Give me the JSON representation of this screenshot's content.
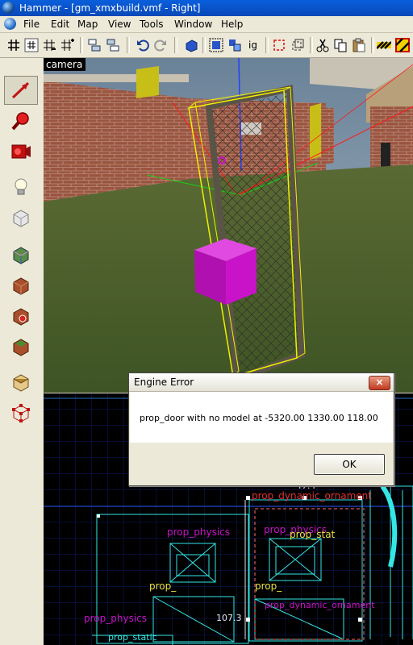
{
  "window": {
    "title": "Hammer - [gm_xmxbuild.vmf - Right]"
  },
  "menu": {
    "items": [
      "File",
      "Edit",
      "Map",
      "View",
      "Tools",
      "Window",
      "Help"
    ]
  },
  "toolbar": {
    "items": [
      "grid-icon",
      "grid-toggle-icon",
      "grid-smaller-icon",
      "grid-larger-icon",
      "group-icon",
      "ungroup-icon",
      "undo-icon",
      "redo-icon",
      "carve-icon",
      "selection-icon",
      "texture-lock-icon",
      "ignore-groups-label",
      "hide-icon",
      "show-icon",
      "cut-icon",
      "copy-icon",
      "paste-icon",
      "hazard-a-icon",
      "hazard-b-icon"
    ],
    "ignore_label": "ig"
  },
  "tools": [
    "selection-tool-icon",
    "magnify-tool-icon",
    "camera-tool-icon",
    "entity-tool-icon",
    "block-tool-icon",
    "texture-app-icon",
    "apply-texture-icon",
    "decal-tool-icon",
    "overlay-tool-icon",
    "clipping-tool-icon",
    "vertex-tool-icon"
  ],
  "camera_view": {
    "label": "camera"
  },
  "view2d": {
    "labels": {
      "prop_dynamic_ornament": "prop_dynamic_ornament",
      "measure_top": "47.4",
      "prop_physics_1": "prop_physics",
      "prop_physics_2": "prop_physics",
      "prop_static_1": "prop_stat",
      "prop_1": "prop_",
      "prop_2": "prop_",
      "prop_physics_3": "prop_physics",
      "measure_left": "107.3",
      "prop_dynamic_ornament_2": "prop_dynamic_ornament",
      "prop_static_2": "prop_static"
    }
  },
  "dialog": {
    "title": "Engine Error",
    "close": "×",
    "message": "prop_door with no model at -5320.00 1330.00 118.00",
    "ok": "OK"
  },
  "colors": {
    "titlebar": "#0848b8",
    "selection_yellow": "#f0f000",
    "entity_magenta": "#c813c8",
    "wire_cyan": "#34e6e6",
    "label_red": "#e03030",
    "grid_blue": "#0a1c66"
  }
}
